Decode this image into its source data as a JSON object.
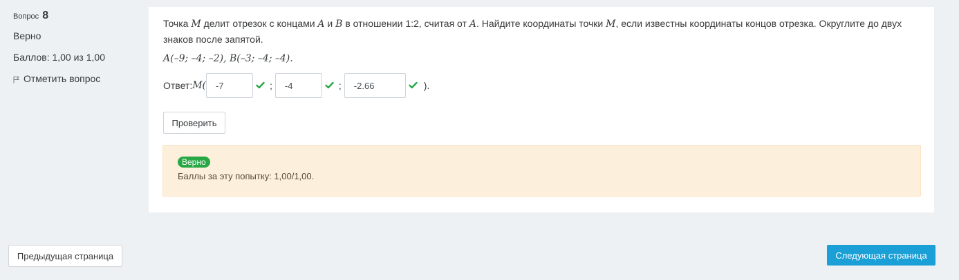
{
  "info": {
    "question_label": "Вопрос",
    "question_number": "8",
    "state": "Верно",
    "grade": "Баллов: 1,00 из 1,00",
    "flag_label": "Отметить вопрос"
  },
  "question": {
    "t1": "Точка ",
    "v_m": "M",
    "t2": " делит отрезок с концами ",
    "v_a": "A",
    "t3": " и ",
    "v_b": "B",
    "t4": " в отношении 1:2, считая от ",
    "v_a2": "A",
    "t5": ". Найдите координаты точки ",
    "v_m2": "M",
    "t6": ", если известны координаты концов отрезка. Округлите до двух знаков после запятой.",
    "coords": "A(–9; –4; –2), B(–3; –4; –4)."
  },
  "answer": {
    "prefix": "Ответ: ",
    "point": "M(",
    "separator": ";",
    "suffix": ").",
    "values": [
      "-7",
      "-4",
      "-2.66"
    ]
  },
  "buttons": {
    "check": "Проверить",
    "prev": "Предыдущая страница",
    "next": "Следующая страница"
  },
  "feedback": {
    "badge": "Верно",
    "text": "Баллы за эту попытку: 1,00/1,00."
  },
  "colors": {
    "accent": "#1a9fd6",
    "correct": "#28a745",
    "feedback_bg": "#fcefdc"
  }
}
